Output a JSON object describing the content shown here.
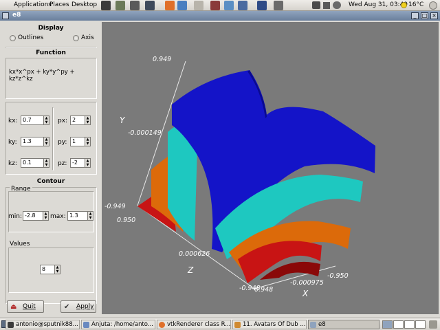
{
  "top_panel": {
    "menus": [
      "Applications",
      "Places",
      "Desktop"
    ],
    "launchers": [
      {
        "icon": "terminal-icon",
        "color": "#3b3b3b"
      },
      {
        "icon": "gimp-icon",
        "color": "#6c7a58"
      },
      {
        "icon": "gear-icon",
        "color": "#5a5a5a"
      },
      {
        "icon": "monitor-icon",
        "color": "#3f4a5c"
      },
      {
        "icon": "firefox-icon",
        "color": "#e0702a"
      },
      {
        "icon": "browser-icon",
        "color": "#4a7fc0"
      },
      {
        "icon": "system-icon",
        "color": "#b8b4ab"
      },
      {
        "icon": "draw-icon",
        "color": "#8a3a3a"
      },
      {
        "icon": "paint-icon",
        "color": "#5b8fc4"
      },
      {
        "icon": "stats-icon",
        "color": "#4a6aa0"
      },
      {
        "icon": "font-a-icon",
        "color": "#2e4a86"
      },
      {
        "icon": "tools-icon",
        "color": "#6a6a6a"
      }
    ],
    "clock": "Wed Aug 31, 03:49",
    "temperature": "16°C"
  },
  "window": {
    "title": "e8"
  },
  "side_panel": {
    "display_title": "Display",
    "outlines_label": "Outlines",
    "axis_label": "Axis",
    "function_title": "Function",
    "function_text": "kx*x^px + ky*y^py + kz*z^kz",
    "params": [
      {
        "label": "kx:",
        "value": "0.7"
      },
      {
        "label": "px:",
        "value": "2"
      },
      {
        "label": "ky:",
        "value": "1.3"
      },
      {
        "label": "py:",
        "value": "1"
      },
      {
        "label": "kz:",
        "value": "0.1"
      },
      {
        "label": "pz:",
        "value": "-2"
      }
    ],
    "contour_title": "Contour",
    "range_label": "Range",
    "min_label": "min:",
    "min_value": "-2.8",
    "max_label": "max:",
    "max_value": "1.3",
    "values_label": "Values",
    "values_count": "8",
    "quit_label": "Quit",
    "apply_label": "Apply"
  },
  "viewport": {
    "labels": {
      "y_axis": "Y",
      "z_axis": "Z",
      "x_axis": "X",
      "y_top": "0.949",
      "y_mid": "-0.000149",
      "y_bottom": "-0.949",
      "z_back": "0.950",
      "z_mid": "0.000626",
      "z_front": "-0.948",
      "x_left": "0.948",
      "x_mid": "-0.000975",
      "x_right": "-0.950"
    },
    "colors": {
      "background": "#7a7a7a",
      "blue": "#1414c8",
      "cyan": "#1ec8c0",
      "orange": "#dc6a0a",
      "red": "#c81414"
    }
  },
  "taskbar": {
    "tasks": [
      {
        "label": "antonio@sputnik88...",
        "icon_color": "#3b3b3b"
      },
      {
        "label": "Anjuta: /home/anto...",
        "icon_color": "#6a8ac0"
      },
      {
        "label": "vtkRenderer class R...",
        "icon_color": "#e0702a"
      },
      {
        "label": "11. Avatars Of Dub ...",
        "icon_color": "#d08a30"
      },
      {
        "label": "e8",
        "icon_color": "#8fa3bd"
      }
    ]
  }
}
